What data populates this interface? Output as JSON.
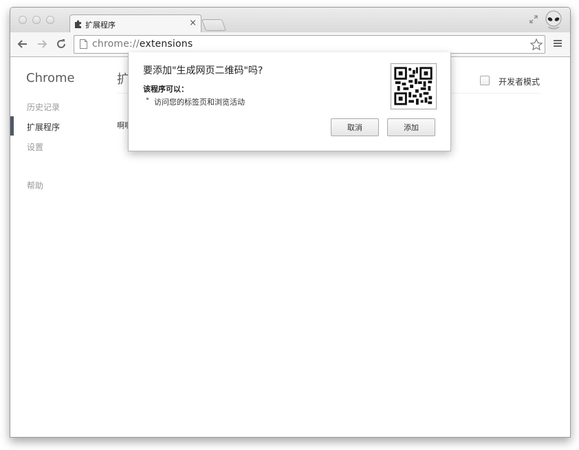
{
  "tab": {
    "title": "扩展程序",
    "close_glyph": "×"
  },
  "address_bar": {
    "scheme": "chrome://",
    "path": "extensions"
  },
  "sidebar": {
    "brand": "Chrome",
    "items": [
      {
        "label": "历史记录",
        "active": false
      },
      {
        "label": "扩展程序",
        "active": true
      },
      {
        "label": "设置",
        "active": false
      },
      {
        "label": "帮助",
        "active": false
      }
    ]
  },
  "main": {
    "title": "扩",
    "extension_item": "啊啊",
    "developer_mode": {
      "label": "开发者模式",
      "checked": false
    }
  },
  "dialog": {
    "title": "要添加\"生成网页二维码\"吗?",
    "permissions_heading": "该程序可以：",
    "permissions": [
      "访问您的标签页和浏览活动"
    ],
    "cancel_label": "取消",
    "add_label": "添加"
  },
  "icons": {
    "tab": "puzzle-icon",
    "back": "back-arrow-icon",
    "forward": "forward-arrow-icon",
    "reload": "reload-icon",
    "page": "page-icon",
    "star": "star-icon",
    "menu": "menu-icon",
    "fullscreen": "fullscreen-icon",
    "avatar": "alien-avatar-icon",
    "extension": "qr-code-icon"
  },
  "colors": {
    "sidebar_marker": "#4f5867"
  }
}
